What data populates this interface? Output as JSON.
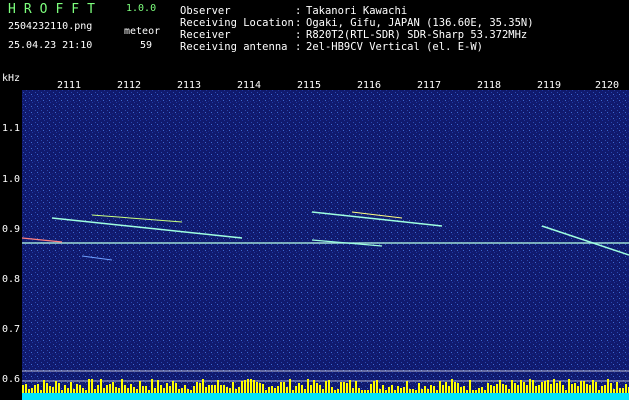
{
  "header": {
    "title": "HROFFT",
    "version": "1.0.0",
    "filename": "2504232110.png",
    "meteor_label": "meteor",
    "datetime": "25.04.23 21:10",
    "meteor_count": "59"
  },
  "info": [
    {
      "label": "Observer",
      "value": "Takanori Kawachi"
    },
    {
      "label": "Receiving Location",
      "value": "Ogaki, Gifu, JAPAN (136.60E, 35.35N)"
    },
    {
      "label": "Receiver",
      "value": "R820T2(RTL-SDR) SDR-Sharp 53.372MHz"
    },
    {
      "label": "Receiving antenna",
      "value": "2el-HB9CV Vertical (el. E-W)"
    }
  ],
  "axis": {
    "y_unit": "kHz",
    "y_ticks": [
      "1.1",
      "1.0",
      "0.9",
      "0.8",
      "0.7",
      "0.6"
    ],
    "x_ticks": [
      "2111",
      "2112",
      "2113",
      "2114",
      "2115",
      "2116",
      "2117",
      "2118",
      "2119",
      "2120"
    ]
  },
  "colors": {
    "background": "#000000",
    "title": "#7dff7d",
    "text": "#ffffff",
    "spectrogram_bg": "#101a6e",
    "signal": "#9fffe0",
    "level_bars": "#ffff00"
  }
}
